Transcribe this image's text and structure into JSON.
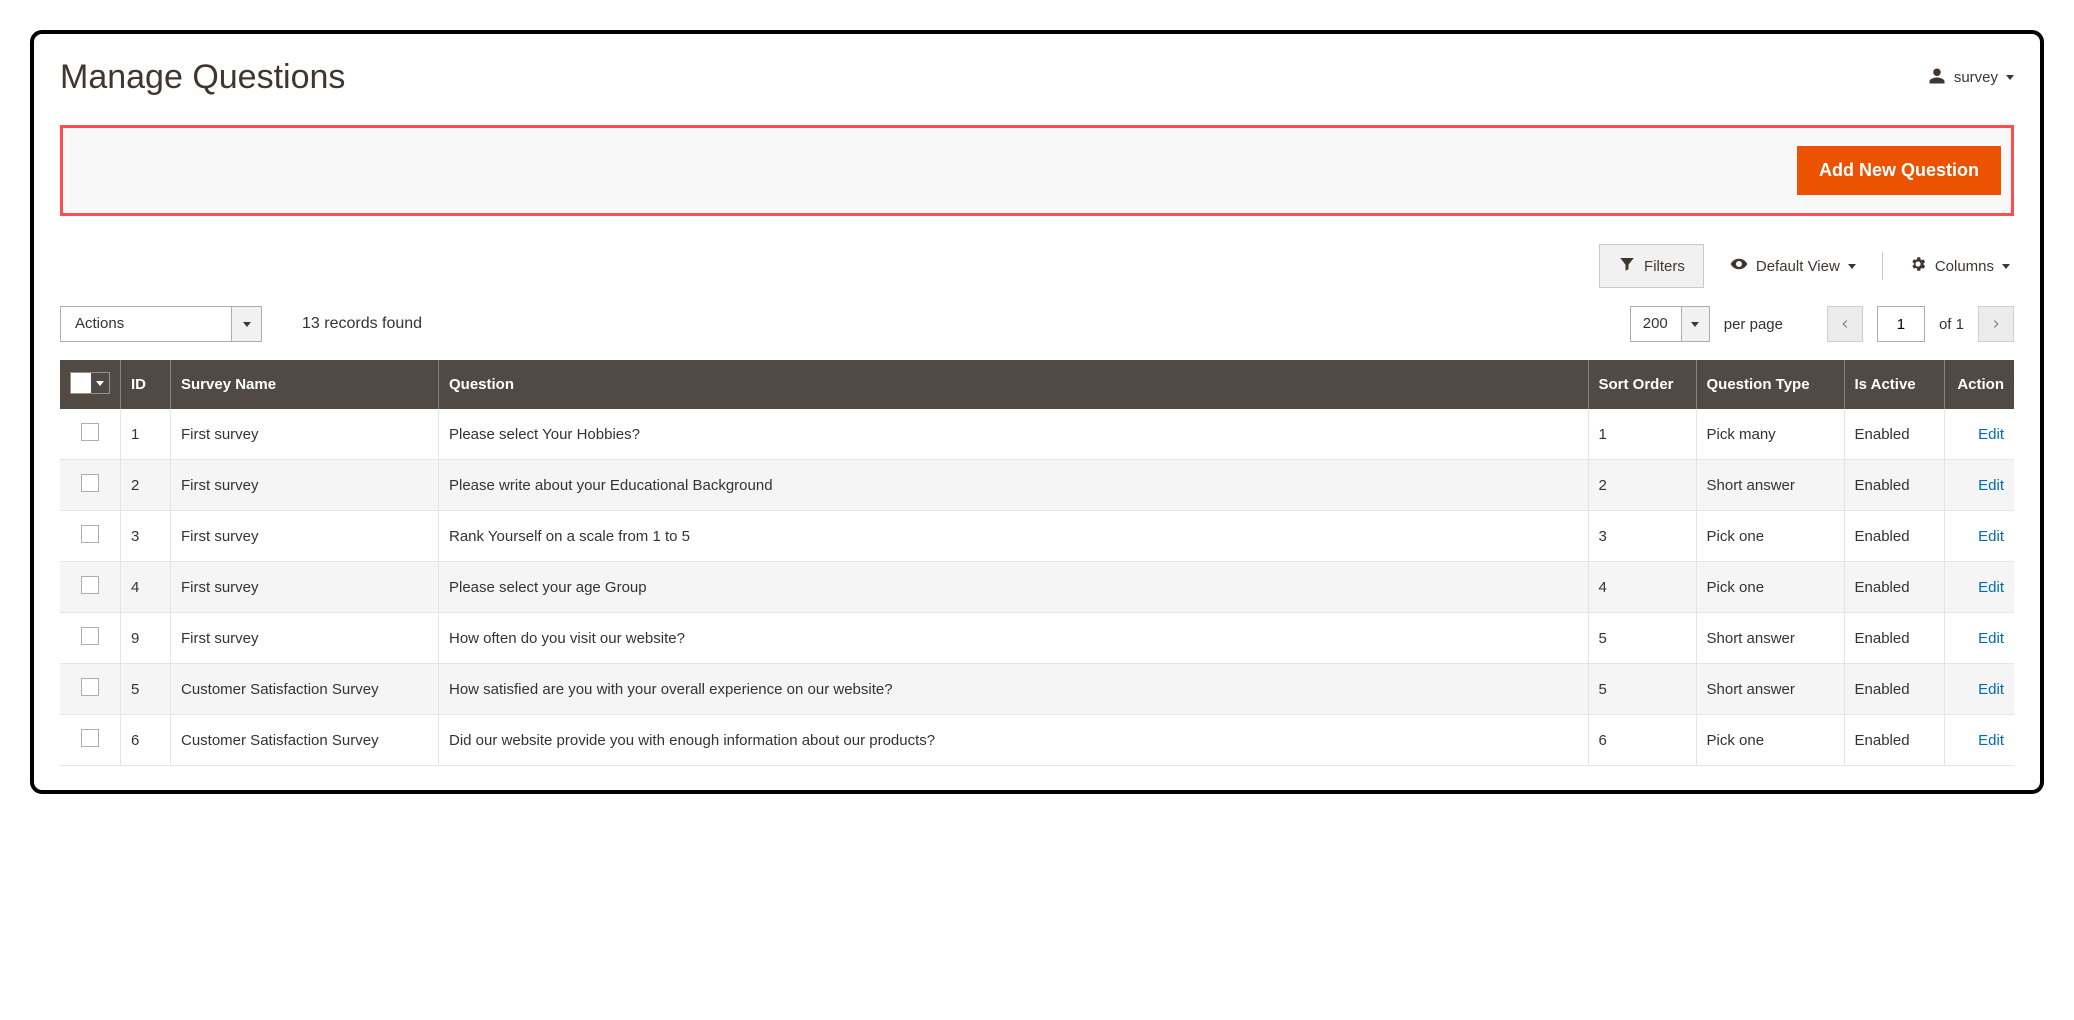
{
  "header": {
    "title": "Manage Questions",
    "user_label": "survey"
  },
  "actions": {
    "primary_button": "Add New Question"
  },
  "toolbar": {
    "filters": "Filters",
    "default_view": "Default View",
    "columns": "Columns"
  },
  "controls": {
    "actions_label": "Actions",
    "records_found": "13 records found",
    "page_size": "200",
    "per_page_label": "per page",
    "current_page": "1",
    "of_label": "of 1"
  },
  "table": {
    "headers": {
      "id": "ID",
      "survey_name": "Survey Name",
      "question": "Question",
      "sort_order": "Sort Order",
      "question_type": "Question Type",
      "is_active": "Is Active",
      "action": "Action"
    },
    "edit_label": "Edit",
    "rows": [
      {
        "id": "1",
        "survey": "First survey",
        "question": "Please select Your Hobbies?",
        "sort": "1",
        "qtype": "Pick many",
        "active": "Enabled"
      },
      {
        "id": "2",
        "survey": "First survey",
        "question": "Please write about your Educational Background",
        "sort": "2",
        "qtype": "Short answer",
        "active": "Enabled"
      },
      {
        "id": "3",
        "survey": "First survey",
        "question": "Rank Yourself on a scale from 1 to 5",
        "sort": "3",
        "qtype": "Pick one",
        "active": "Enabled"
      },
      {
        "id": "4",
        "survey": "First survey",
        "question": "Please select your age Group",
        "sort": "4",
        "qtype": "Pick one",
        "active": "Enabled"
      },
      {
        "id": "9",
        "survey": "First survey",
        "question": "How often do you visit our website?",
        "sort": "5",
        "qtype": "Short answer",
        "active": "Enabled"
      },
      {
        "id": "5",
        "survey": "Customer Satisfaction Survey",
        "question": "How satisfied are you with your overall experience on our website?",
        "sort": "5",
        "qtype": "Short answer",
        "active": "Enabled"
      },
      {
        "id": "6",
        "survey": "Customer Satisfaction Survey",
        "question": "Did our website provide you with enough information about our products?",
        "sort": "6",
        "qtype": "Pick one",
        "active": "Enabled"
      }
    ]
  }
}
